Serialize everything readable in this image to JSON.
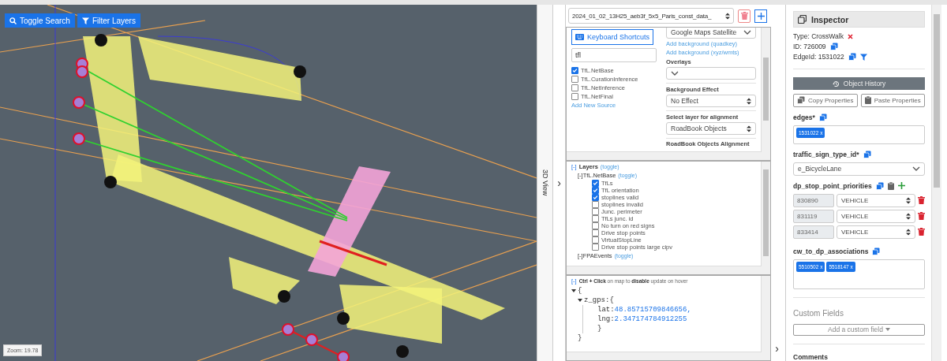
{
  "map": {
    "buttons": [
      {
        "kind": "search",
        "label": "Toggle Search"
      },
      {
        "kind": "filter",
        "label": "Filter Layers"
      }
    ],
    "zoom": "Zoom: 19.78"
  },
  "view_3d": {
    "label": "3D View",
    "expand": "›"
  },
  "dataset": {
    "value": "2024_01_02_13H25_aeb3f_5x5_Paris_const_data_"
  },
  "sources": {
    "shortcuts_button": "Keyboard Shortcuts",
    "search_value": "tfl",
    "items": [
      {
        "label": "TfL.NetBase",
        "checked": true
      },
      {
        "label": "TfL.CurationInference",
        "checked": false
      },
      {
        "label": "TfL.NetInference",
        "checked": false
      },
      {
        "label": "TfL.NetFinal",
        "checked": false
      }
    ],
    "add_link": "Add New Source"
  },
  "background": {
    "value": "Google Maps Satellite",
    "links": [
      "Add background (quadkey)",
      "Add background (xyz/wmts)"
    ],
    "groups": [
      {
        "label": "Overlays",
        "kind": "dropdown"
      },
      {
        "label": "Background Effect",
        "kind": "spinner",
        "value": "No Effect"
      },
      {
        "label": "Select layer for alignment",
        "kind": "spinner",
        "value": "RoadBook Objects"
      }
    ],
    "cut_label": "RoadBook Objects Alignment"
  },
  "layers": {
    "toggle": "[-]",
    "title": "Layers",
    "toggle_link": "(toggle)",
    "groups": [
      {
        "label": "[-]TfL.NetBase",
        "toggle_link": "(toggle)",
        "children": [
          {
            "label": "TfLs",
            "checked": true
          },
          {
            "label": "TfL orientation",
            "checked": true
          },
          {
            "label": "stoplines valid",
            "checked": true
          },
          {
            "label": "stoplines invalid",
            "checked": false
          },
          {
            "label": "Junc. perimeter",
            "checked": false
          },
          {
            "label": "TfLs junc. id",
            "checked": false
          },
          {
            "label": "No turn on red signs",
            "checked": false
          },
          {
            "label": "Drive stop points",
            "checked": false
          },
          {
            "label": "VirtualStopLine",
            "checked": false
          },
          {
            "label": "Drive stop points large cipv",
            "checked": false
          }
        ]
      },
      {
        "label": "[-]FPAEvents",
        "toggle_link": "(toggle)"
      }
    ]
  },
  "hover_info": {
    "toggle": "[-]",
    "hint": "**Ctrl + Click** on map to **disable** update on hover",
    "open_brace": "{",
    "key": "z_gps:{",
    "entries": [
      {
        "key": "lat:",
        "value": "48.85715709846656,"
      },
      {
        "key": "lng:",
        "value": "2.347174784912255"
      }
    ],
    "inner_close": "}",
    "close_brace": "}"
  },
  "side_expand": "›",
  "inspector": {
    "title": "Inspector",
    "type": "Type: CrossWalk",
    "id": "ID: 726009",
    "edge_id": "EdgeId: 1531022",
    "history_button": "Object History",
    "copy_button": "Copy Properties",
    "paste_button": "Paste Properties",
    "fields": [
      {
        "kind": "tags",
        "label": "edges*",
        "tags": [
          {
            "label": "1531022",
            "remove": "x"
          }
        ]
      },
      {
        "kind": "select",
        "label": "traffic_sign_type_id*",
        "value": "e_BicycleLane"
      },
      {
        "kind": "priorities",
        "label": "dp_stop_point_priorities",
        "rows": [
          {
            "id": "830890",
            "value": "VEHICLE"
          },
          {
            "id": "831119",
            "value": "VEHICLE"
          },
          {
            "id": "833414",
            "value": "VEHICLE"
          }
        ]
      },
      {
        "kind": "tags",
        "label": "cw_to_dp_associations",
        "tags": [
          {
            "label": "5510502",
            "remove": "x"
          },
          {
            "label": "5518147",
            "remove": "x"
          }
        ]
      }
    ],
    "custom_title": "Custom Fields",
    "custom_button": "Add a custom field",
    "comments": "Comments"
  }
}
